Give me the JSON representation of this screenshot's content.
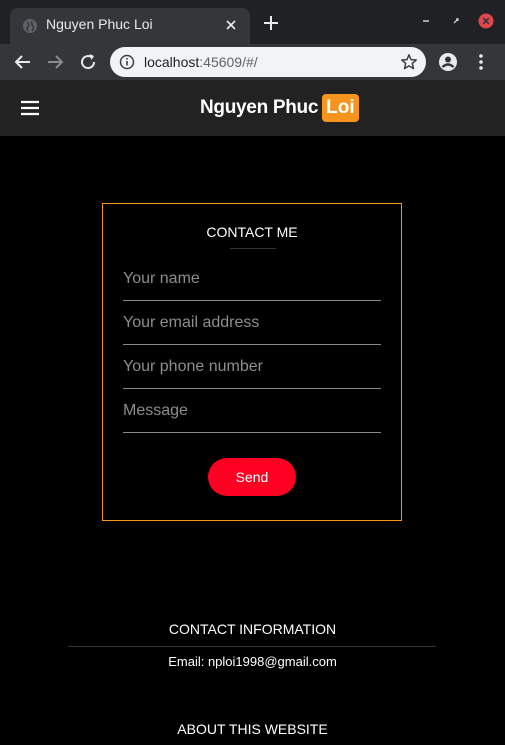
{
  "browser": {
    "tab_title": "Nguyen Phuc Loi",
    "url_host": "localhost",
    "url_rest": ":45609/#/"
  },
  "site": {
    "brand_main": "Nguyen Phuc",
    "brand_accent": "Loi",
    "accent_color": "#f7941d"
  },
  "contact_form": {
    "title": "CONTACT ME",
    "name_placeholder": "Your name",
    "email_placeholder": "Your email address",
    "phone_placeholder": "Your phone number",
    "message_placeholder": "Message",
    "send_label": "Send",
    "send_color": "#ff0022"
  },
  "contact_info": {
    "title": "CONTACT INFORMATION",
    "email_line": "Email: nploi1998@gmail.com"
  },
  "about": {
    "title": "ABOUT THIS WEBSITE"
  }
}
